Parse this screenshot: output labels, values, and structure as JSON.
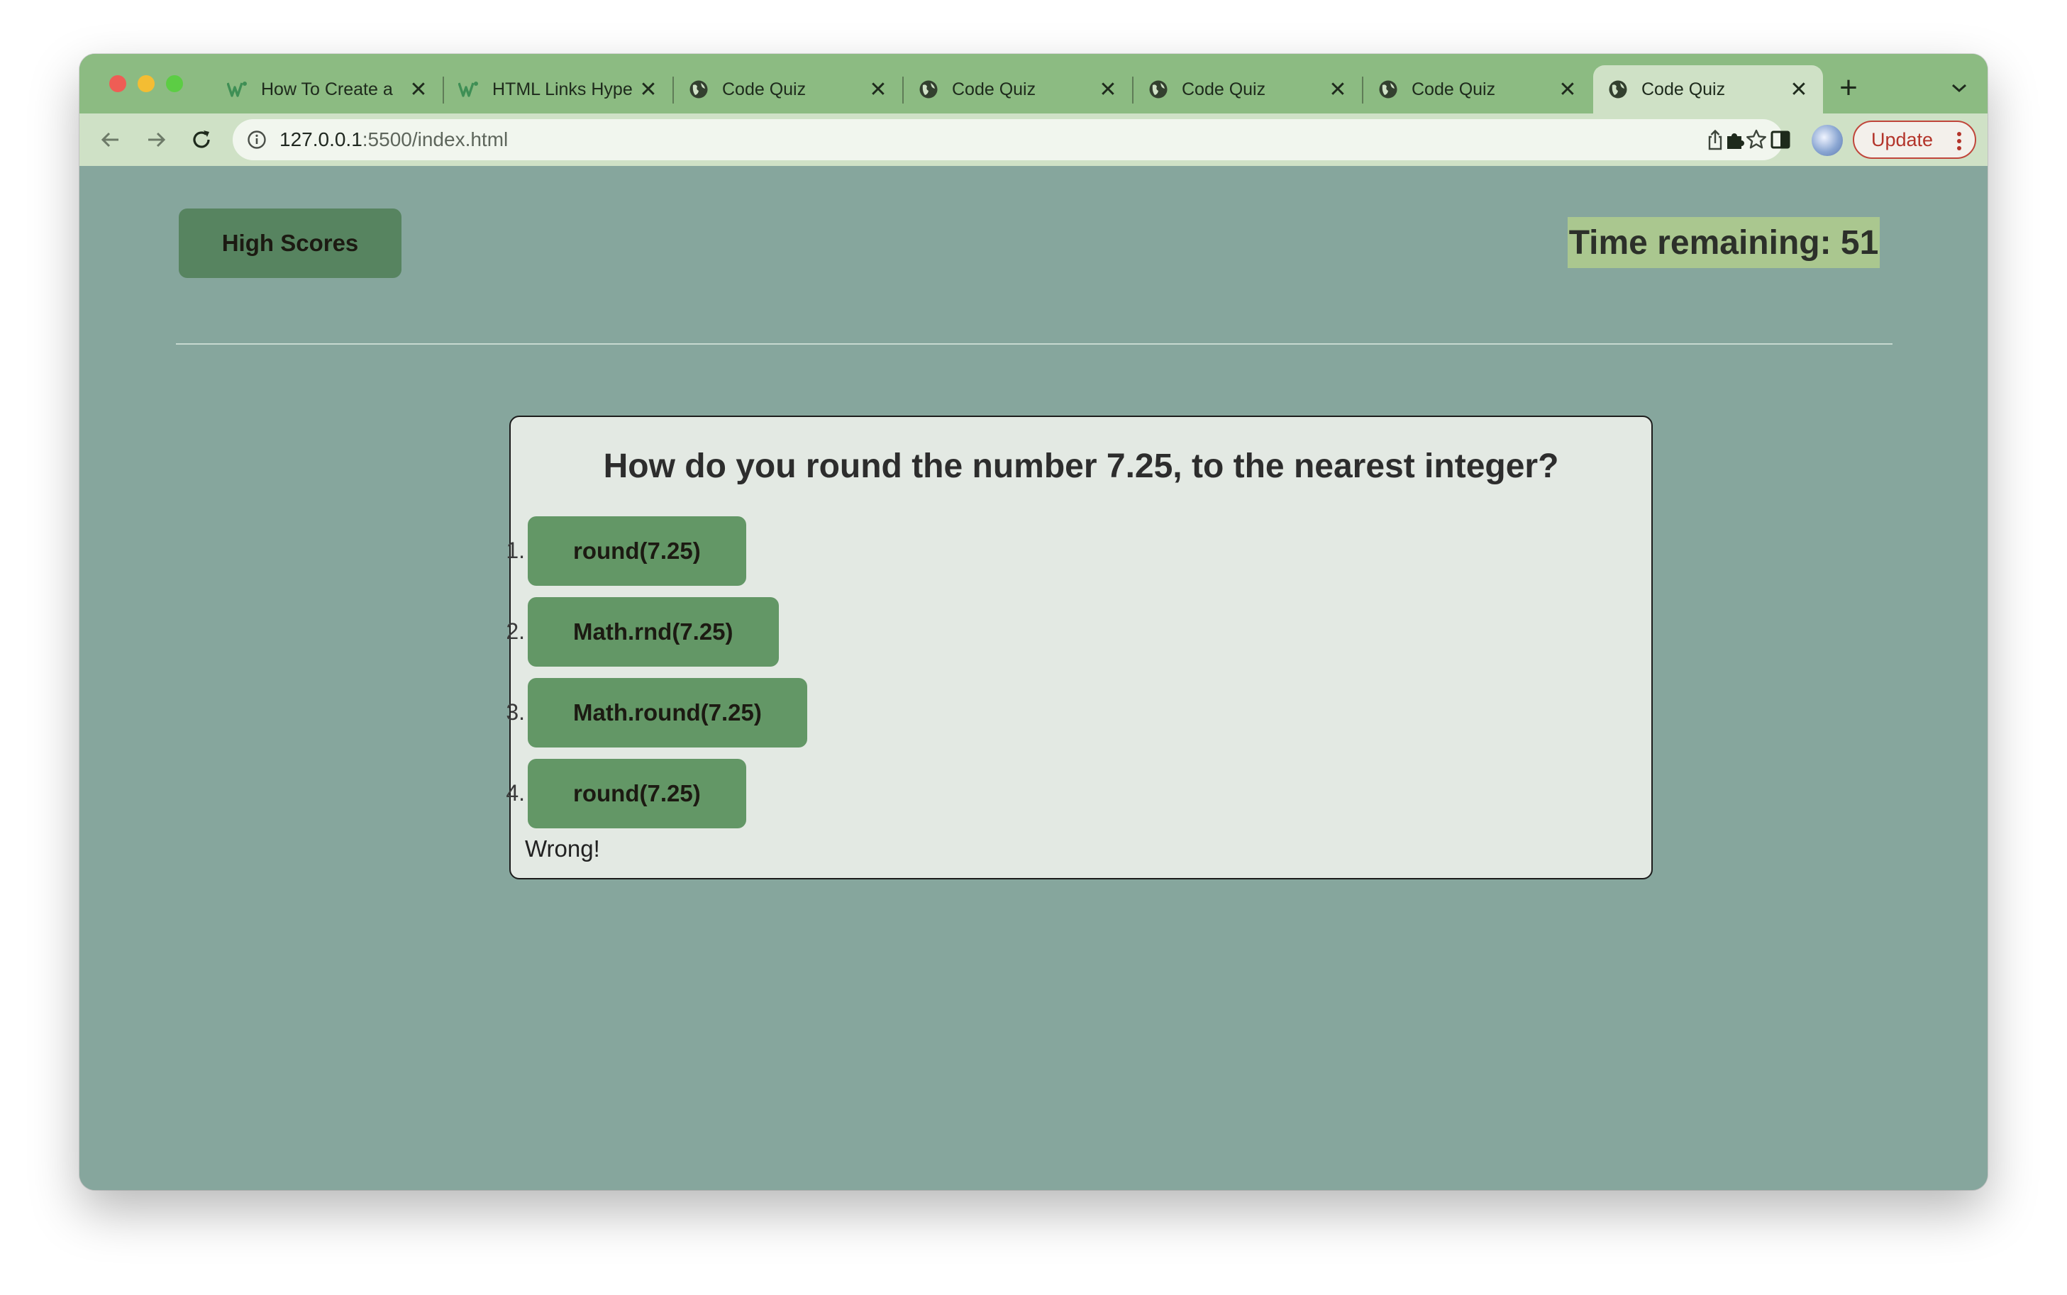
{
  "browser": {
    "tabs": [
      {
        "title": "How To Create a",
        "favicon": "w3schools-icon",
        "active": false
      },
      {
        "title": "HTML Links Hype",
        "favicon": "w3schools-icon",
        "active": false
      },
      {
        "title": "Code Quiz",
        "favicon": "globe-icon",
        "active": false
      },
      {
        "title": "Code Quiz",
        "favicon": "globe-icon",
        "active": false
      },
      {
        "title": "Code Quiz",
        "favicon": "globe-icon",
        "active": false
      },
      {
        "title": "Code Quiz",
        "favicon": "globe-icon",
        "active": false
      },
      {
        "title": "Code Quiz",
        "favicon": "globe-icon",
        "active": true
      }
    ],
    "close_glyph": "✕",
    "new_tab_glyph": "+",
    "address": {
      "host": "127.0.0.1",
      "path": ":5500/index.html"
    },
    "update_label": "Update"
  },
  "page": {
    "high_scores_label": "High Scores",
    "timer_text": "Time remaining: 51",
    "question": "How do you round the number 7.25, to the nearest integer?",
    "answers": [
      {
        "number": "1.",
        "label": "round(7.25)"
      },
      {
        "number": "2.",
        "label": "Math.rnd(7.25)"
      },
      {
        "number": "3.",
        "label": "Math.round(7.25)"
      },
      {
        "number": "4.",
        "label": "round(7.25)"
      }
    ],
    "feedback": "Wrong!"
  },
  "colors": {
    "tabstrip": "#8cbb82",
    "toolbar": "#cfe1c6",
    "page_background": "#86a69d",
    "card_background": "#e3e9e3",
    "answer_button": "#639766",
    "high_scores_button": "#578460",
    "timer_highlight": "#aac78f",
    "update_accent": "#c0463b"
  }
}
